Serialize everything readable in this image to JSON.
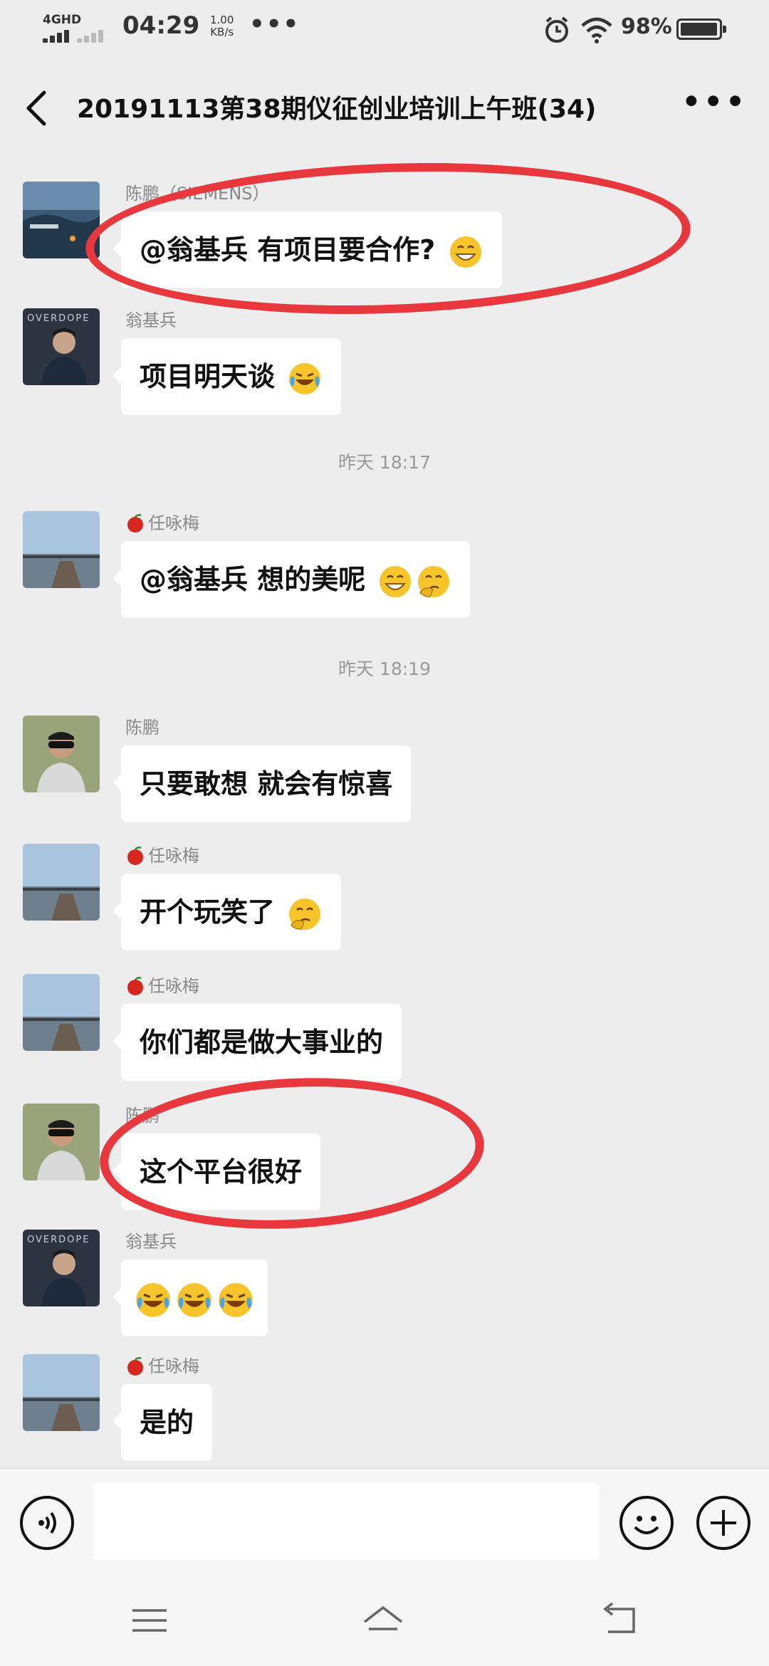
{
  "status_bar": {
    "network": "4GHD",
    "time": "04:29",
    "speed_value": "1.00",
    "speed_unit": "KB/s",
    "overflow": "•••",
    "battery_percent": "98%",
    "battery_level": 0.98
  },
  "header": {
    "title": "20191113第38期仪征创业培训上午班(34)",
    "more": "•••"
  },
  "messages": [
    {
      "sender": "陈鹏（SIEMENS）",
      "text": "@翁基兵  有项目要合作?",
      "emoji": "grin"
    },
    {
      "sender": "翁基兵",
      "text": "项目明天谈",
      "emoji": "laugh-cry"
    },
    {
      "timestamp": "昨天 18:17"
    },
    {
      "sender": "任咏梅",
      "text": "@翁基兵  想的美呢",
      "emoji": "grin+think"
    },
    {
      "timestamp": "昨天 18:19"
    },
    {
      "sender": "陈鹏",
      "text": "只要敢想 就会有惊喜"
    },
    {
      "sender": "任咏梅",
      "text": "开个玩笑了",
      "emoji": "think"
    },
    {
      "sender": "任咏梅",
      "text": "你们都是做大事业的"
    },
    {
      "sender": "陈鹏",
      "text": "这个平台很好"
    },
    {
      "sender": "翁基兵",
      "text": "",
      "emoji": "laugh-cry x3"
    },
    {
      "sender": "任咏梅",
      "text": "是的"
    }
  ],
  "input": {
    "placeholder": ""
  },
  "colors": {
    "accent_ring": "#e8383d",
    "chat_bg": "#ededed",
    "bubble": "#ffffff"
  }
}
